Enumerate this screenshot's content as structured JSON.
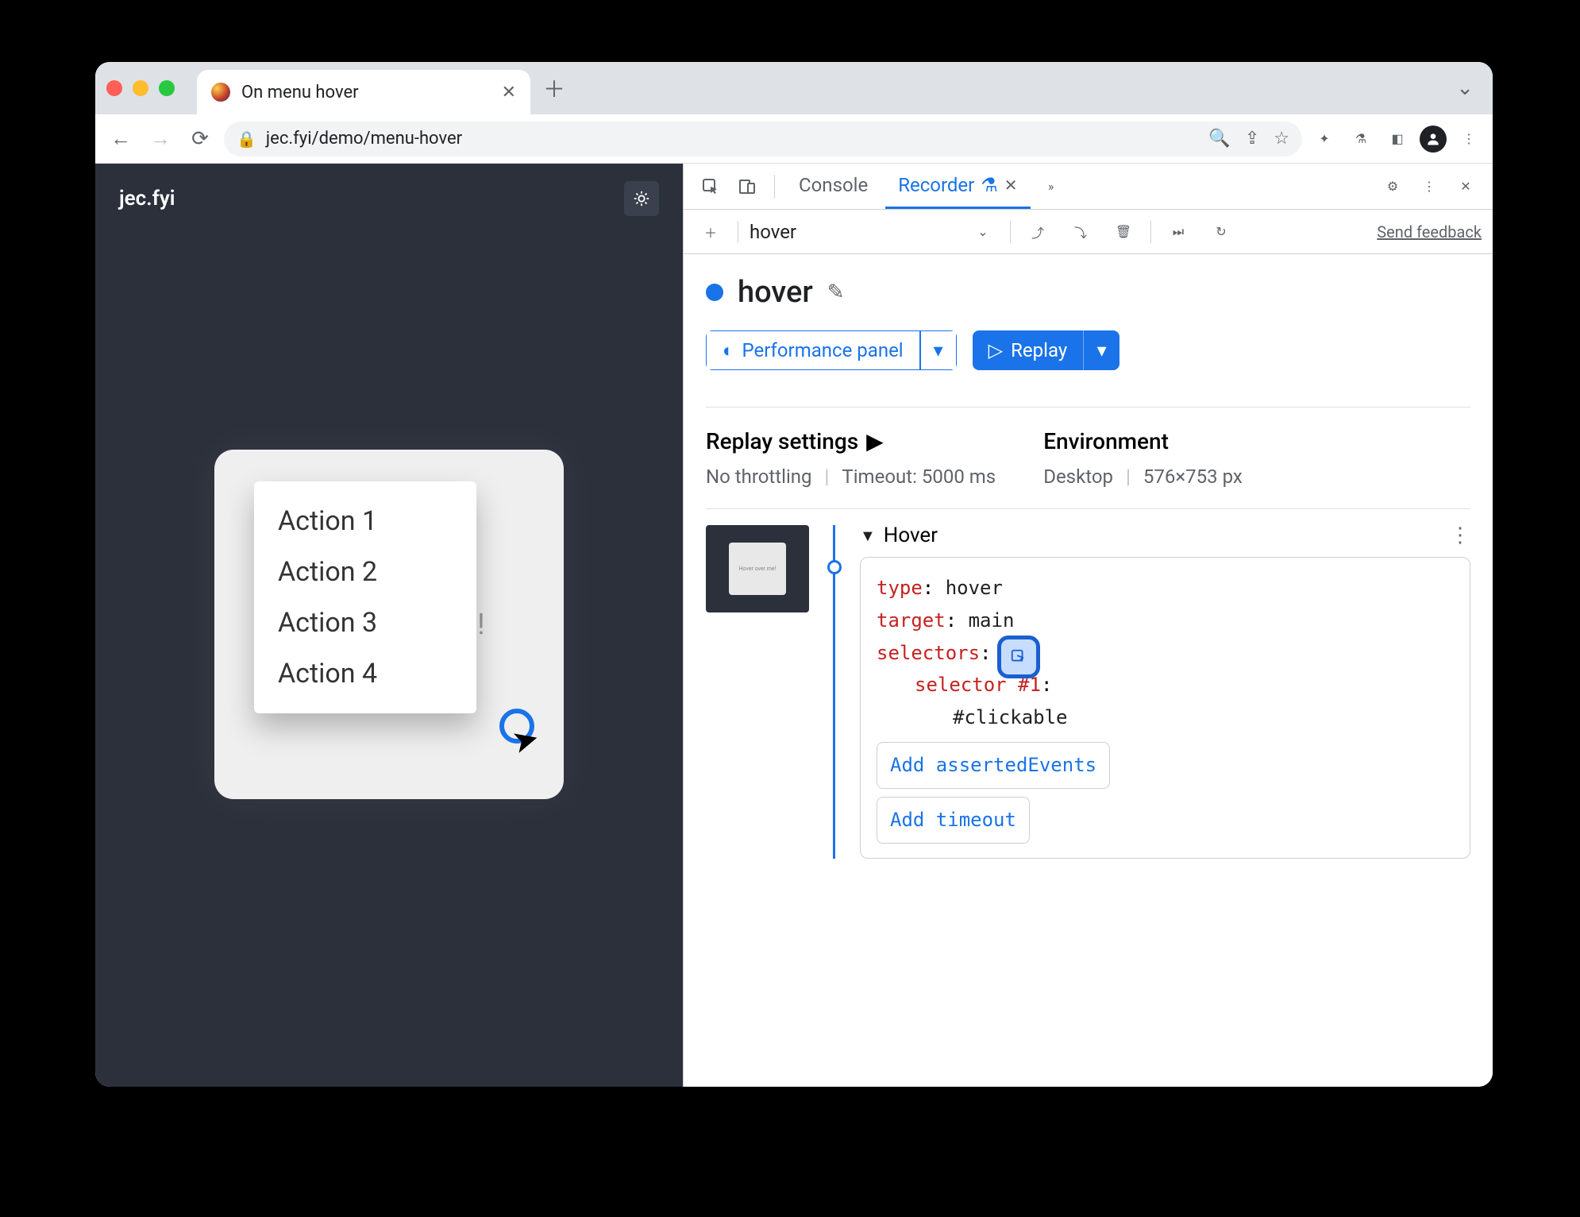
{
  "browser": {
    "tab_title": "On menu hover",
    "url": "jec.fyi/demo/menu-hover"
  },
  "page": {
    "brand": "jec.fyi",
    "hint": "Hover over me!",
    "menu_items": [
      "Action 1",
      "Action 2",
      "Action 3",
      "Action 4"
    ]
  },
  "devtools": {
    "tabs": {
      "console": "Console",
      "recorder": "Recorder"
    },
    "recording_name": "hover",
    "feedback": "Send feedback",
    "title": "hover",
    "perf_btn": "Performance panel",
    "replay_btn": "Replay",
    "settings": {
      "replay_h": "Replay settings",
      "throttling": "No throttling",
      "timeout": "Timeout: 5000 ms",
      "env_h": "Environment",
      "device": "Desktop",
      "viewport": "576×753 px"
    },
    "step": {
      "title": "Hover",
      "type_k": "type",
      "type_v": "hover",
      "target_k": "target",
      "target_v": "main",
      "selectors_k": "selectors",
      "selector_label": "selector #1",
      "selector_value": "#clickable",
      "add_asserted": "Add assertedEvents",
      "add_timeout": "Add timeout"
    }
  }
}
